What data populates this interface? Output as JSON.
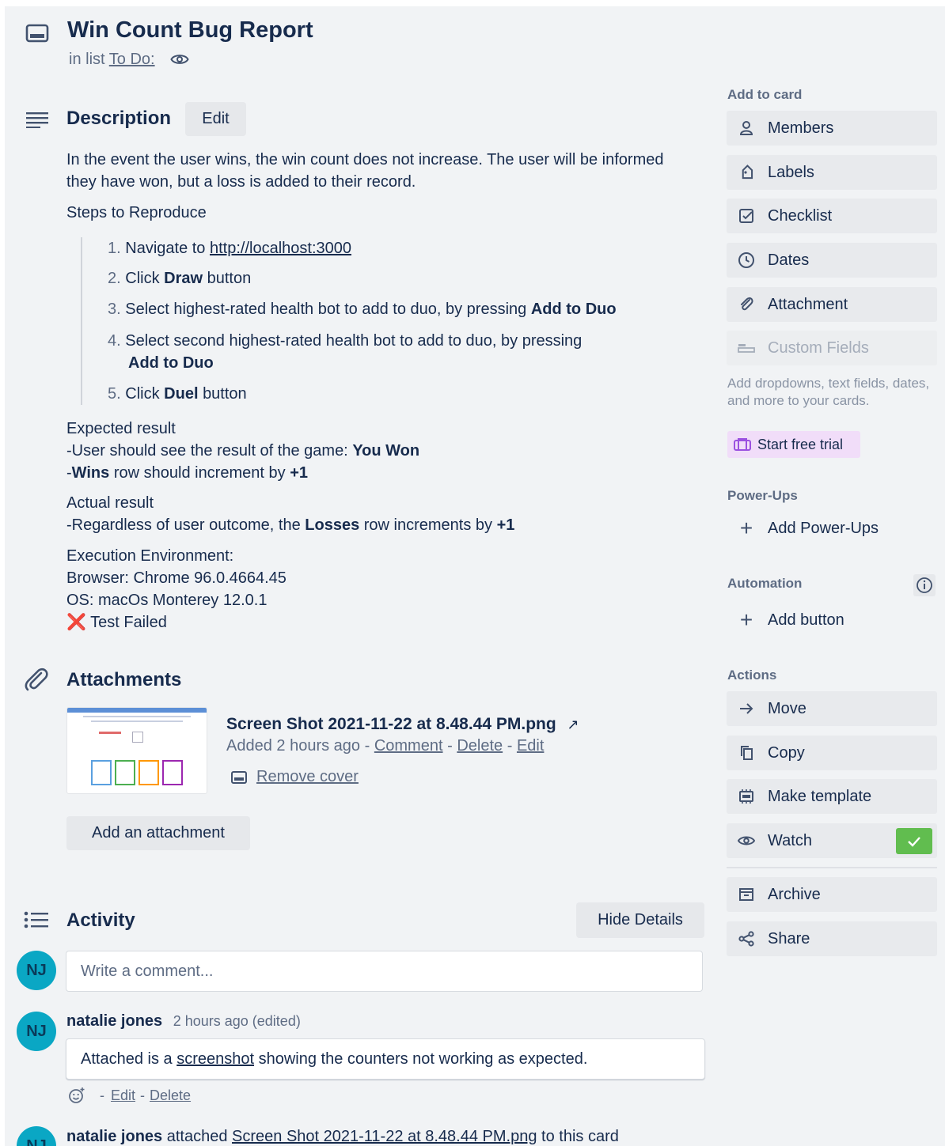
{
  "header": {
    "title": "Win Count Bug Report",
    "in_list_prefix": "in list",
    "list_name": "To Do:",
    "icons": {
      "card": "card-icon",
      "watch": "eye-icon"
    }
  },
  "description": {
    "title": "Description",
    "edit_label": "Edit",
    "paragraph": "In the event the user wins, the win count does not increase. The user will be informed they have won, but a loss is added to their record.",
    "steps_heading": "Steps to Reproduce",
    "steps": [
      {
        "num": "1.",
        "pre": "Navigate to",
        "link": "http://localhost:3000"
      },
      {
        "num": "2.",
        "pre": "Click",
        "bold": "Draw",
        "post": "button"
      },
      {
        "num": "3.",
        "pre": "Select highest-rated health bot to add to duo, by pressing",
        "bold": "Add to Duo"
      },
      {
        "num": "4.",
        "pre": "Select second highest-rated health bot to add to duo, by pressing",
        "bold": "Add to Duo"
      },
      {
        "num": "5.",
        "pre": "Click",
        "bold": "Duel",
        "post": "button"
      }
    ],
    "expected_heading": "Expected result",
    "expected_line1_pre": "-User should see the result of the game:",
    "expected_line1_bold": "You Won",
    "expected_line2_dash": "-",
    "expected_line2_bold": "Wins",
    "expected_line2_mid": "row should increment by",
    "expected_line2_bold2": "+1",
    "actual_heading": "Actual result",
    "actual_pre": "-Regardless of user outcome, the",
    "actual_bold": "Losses",
    "actual_mid": "row increments by",
    "actual_bold2": "+1",
    "env_heading": "Execution Environment:",
    "env_browser": "Browser: Chrome 96.0.4664.45",
    "env_os": "OS: macOs Monterey 12.0.1",
    "status_mark": "❌",
    "status_text": "Test Failed"
  },
  "attachments": {
    "title": "Attachments",
    "file_name": "Screen Shot 2021-11-22 at 8.48.44 PM.png",
    "added": "Added 2 hours ago",
    "sep": "-",
    "comment_label": "Comment",
    "delete_label": "Delete",
    "edit_label": "Edit",
    "remove_cover_label": "Remove cover",
    "add_label": "Add an attachment"
  },
  "activity": {
    "title": "Activity",
    "hide_details_label": "Hide Details",
    "avatar_initials": "NJ",
    "comment_placeholder": "Write a comment...",
    "entries": [
      {
        "author": "natalie jones",
        "time": "2 hours ago (edited)",
        "text_pre": "Attached is a",
        "text_link": "screenshot",
        "text_post": "showing the counters not working as expected.",
        "edit_label": "Edit",
        "delete_label": "Delete",
        "sep": "-"
      },
      {
        "author": "natalie jones",
        "action": "attached",
        "file": "Screen Shot 2021-11-22 at 8.48.44 PM.png",
        "suffix": "to this card"
      }
    ]
  },
  "sidebar": {
    "add_to_card": "Add to card",
    "items": [
      {
        "label": "Members",
        "icon": "person-icon"
      },
      {
        "label": "Labels",
        "icon": "tag-icon"
      },
      {
        "label": "Checklist",
        "icon": "checklist-icon"
      },
      {
        "label": "Dates",
        "icon": "clock-icon"
      },
      {
        "label": "Attachment",
        "icon": "paperclip-icon"
      },
      {
        "label": "Custom Fields",
        "icon": "fields-icon"
      }
    ],
    "custom_fields_desc": "Add dropdowns, text fields, dates, and more to your cards.",
    "start_trial_label": "Start free trial",
    "power_ups_label": "Power-Ups",
    "add_power_ups": "Add Power-Ups",
    "automation_label": "Automation",
    "add_button": "Add button",
    "actions_label": "Actions",
    "actions": [
      {
        "label": "Move",
        "icon": "arrow-right-icon"
      },
      {
        "label": "Copy",
        "icon": "copy-icon"
      },
      {
        "label": "Make template",
        "icon": "template-icon"
      },
      {
        "label": "Watch",
        "icon": "eye-icon"
      },
      {
        "label": "Archive",
        "icon": "archive-icon"
      },
      {
        "label": "Share",
        "icon": "share-icon"
      }
    ],
    "colors": {
      "trial_bg": "#f1ddf9",
      "trial_text": "#172b4d",
      "watch_check": "#61bd4f"
    }
  }
}
